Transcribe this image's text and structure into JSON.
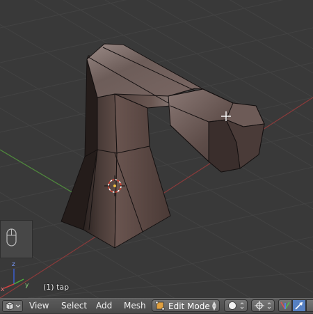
{
  "viewport": {
    "object_label": "(1) tap",
    "axis_x_label": "x",
    "axis_y_label": "y",
    "axis_z_label": "z"
  },
  "header": {
    "menus": [
      "View",
      "Select",
      "Add",
      "Mesh"
    ],
    "mode": "Edit Mode"
  },
  "colors": {
    "viewport_bg": "#393939",
    "grid_line": "#444444",
    "x_axis": "#8b3a3a",
    "y_axis": "#4f8a3b",
    "active_blue": "#5680c2"
  }
}
